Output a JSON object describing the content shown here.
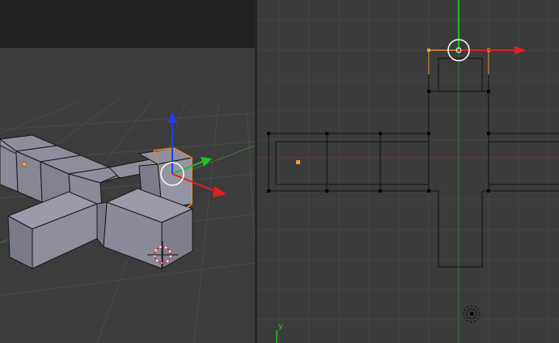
{
  "left_viewport": {
    "view": "user-perspective",
    "show_grid": true,
    "objects": [
      "mesh-cubes",
      "selected-face",
      "origin-dot",
      "3d-cursor",
      "transform-manipulator"
    ]
  },
  "right_viewport": {
    "view": "top-orthographic",
    "axis_label_y": "y",
    "show_grid": true
  },
  "colors": {
    "background": "#3b3b3b",
    "header": "#222222",
    "mesh_face": "#9a9aa8",
    "selection": "#f0901f",
    "axis_x": "#e02020",
    "axis_y": "#20c020",
    "axis_z": "#2040e0",
    "edge": "#111111"
  }
}
